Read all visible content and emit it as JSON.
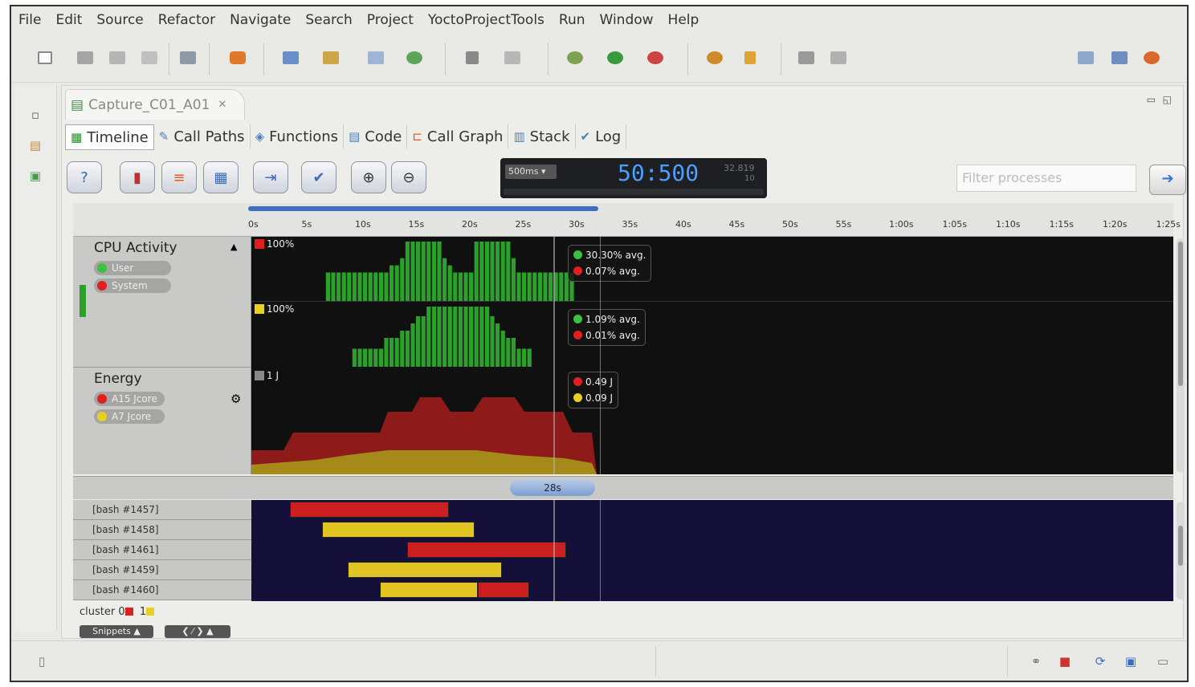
{
  "menu": [
    "File",
    "Edit",
    "Source",
    "Refactor",
    "Navigate",
    "Search",
    "Project",
    "YoctoProjectTools",
    "Run",
    "Window",
    "Help"
  ],
  "editor_tab": {
    "title": "Capture_C01_A01",
    "close": "✕"
  },
  "view_tabs": [
    {
      "label": "Timeline",
      "icon": "timeline-icon"
    },
    {
      "label": "Call Paths",
      "icon": "call-paths-icon"
    },
    {
      "label": "Functions",
      "icon": "functions-icon"
    },
    {
      "label": "Code",
      "icon": "code-icon"
    },
    {
      "label": "Call Graph",
      "icon": "call-graph-icon"
    },
    {
      "label": "Stack",
      "icon": "stack-icon"
    },
    {
      "label": "Log",
      "icon": "log-icon"
    }
  ],
  "lcd": {
    "interval": "500ms ▾",
    "time": "50:500",
    "right_value": "32.819",
    "right_sub": "10"
  },
  "filter": {
    "placeholder": "Filter processes"
  },
  "ruler_ticks": [
    "0s",
    "5s",
    "10s",
    "15s",
    "20s",
    "25s",
    "30s",
    "35s",
    "40s",
    "45s",
    "50s",
    "55s",
    "1:00s",
    "1:05s",
    "1:10s",
    "1:15s",
    "1:20s",
    "1:25s"
  ],
  "cpu": {
    "title": "CPU Activity",
    "series": [
      {
        "name": "User",
        "color": "#3fbf3f"
      },
      {
        "name": "System",
        "color": "#e02020"
      }
    ],
    "scale1": "100%",
    "scale2": "100%",
    "tip1": [
      "30.30% avg.",
      "0.07% avg."
    ],
    "tip2": [
      "1.09% avg.",
      "0.01% avg."
    ]
  },
  "energy": {
    "title": "Energy",
    "series": [
      {
        "name": "A15 Jcore",
        "color": "#e02020"
      },
      {
        "name": "A7 Jcore",
        "color": "#e8d020"
      }
    ],
    "scale": "1 J",
    "tip": [
      "0.49 J",
      "0.09 J"
    ]
  },
  "thumb_label": "28s",
  "processes": [
    {
      "name": "[bash #1457]"
    },
    {
      "name": "[bash #1458]"
    },
    {
      "name": "[bash #1461]"
    },
    {
      "name": "[bash #1459]"
    },
    {
      "name": "[bash #1460]"
    }
  ],
  "cluster": {
    "label": "cluster",
    "c0": "0",
    "c1": "1",
    "c0_color": "#e02020",
    "c1_color": "#e8d020"
  },
  "snippets": {
    "label": "Snippets ▲",
    "nav": "❮ ⁄ ❯ ▲"
  },
  "colors": {
    "red": "#cc1f1f",
    "yellow": "#e2c522",
    "green": "#2aa22a"
  },
  "cpu_chart": {
    "type": "bar",
    "x_range_s": [
      0,
      28
    ],
    "core1_pct": [
      0,
      0,
      0,
      0,
      0,
      0,
      0,
      0,
      48,
      48,
      48,
      48,
      48,
      48,
      48,
      48,
      48,
      48,
      48,
      48,
      60,
      60,
      72,
      100,
      100,
      100,
      100,
      100,
      100,
      100,
      72,
      60,
      48,
      48,
      48,
      48,
      100,
      100,
      100,
      100,
      100,
      100,
      100,
      72,
      48,
      48,
      48,
      48,
      48,
      48,
      48,
      48,
      48,
      48,
      48
    ],
    "core2_pct": [
      0,
      0,
      0,
      0,
      0,
      0,
      0,
      0,
      0,
      0,
      0,
      0,
      0,
      30,
      30,
      30,
      30,
      30,
      30,
      48,
      48,
      48,
      60,
      60,
      72,
      84,
      84,
      100,
      100,
      100,
      100,
      100,
      100,
      100,
      100,
      100,
      100,
      100,
      100,
      84,
      72,
      60,
      48,
      48,
      30,
      30,
      30,
      0,
      0,
      0,
      0,
      0,
      0,
      0,
      0
    ]
  }
}
